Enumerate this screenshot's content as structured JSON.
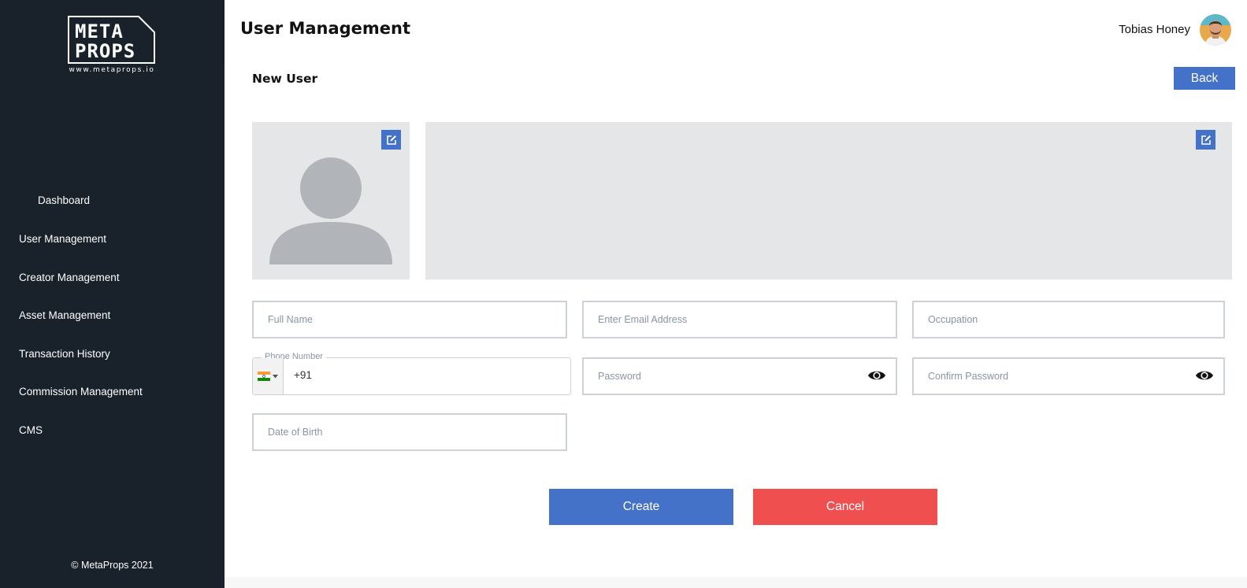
{
  "brand": {
    "logo_line1": "META",
    "logo_line2": "PROPS",
    "url": "www.metaprops.io"
  },
  "sidebar": {
    "items": [
      {
        "label": "Dashboard"
      },
      {
        "label": "User Management"
      },
      {
        "label": "Creator Management"
      },
      {
        "label": "Asset Management"
      },
      {
        "label": "Transaction History"
      },
      {
        "label": "Commission Management"
      },
      {
        "label": "CMS"
      }
    ],
    "copyright": "© MetaProps 2021"
  },
  "header": {
    "title": "User Management",
    "user_name": "Tobias Honey"
  },
  "main": {
    "section_title": "New User",
    "back_label": "Back",
    "form": {
      "full_name_placeholder": "Full Name",
      "email_placeholder": "Enter Email Address",
      "occupation_placeholder": "Occupation",
      "phone_label": "Phone Number",
      "phone_value": "+91",
      "password_placeholder": "Password",
      "confirm_password_placeholder": "Confirm Password",
      "dob_placeholder": "Date of Birth"
    },
    "create_label": "Create",
    "cancel_label": "Cancel"
  },
  "colors": {
    "sidebar_bg": "#19222a",
    "primary": "#4472c9",
    "danger": "#ef4f4f",
    "placeholder_bg": "#e5e6e8"
  }
}
